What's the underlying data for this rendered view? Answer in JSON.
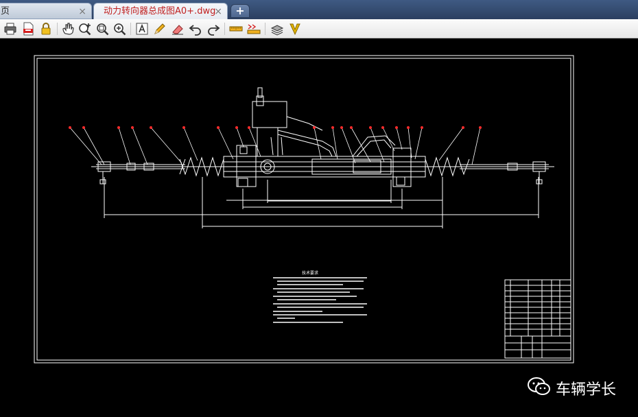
{
  "tabs": [
    {
      "label": "页",
      "active": false
    },
    {
      "label": "动力转向器总成图A0+.dwg",
      "active": true
    }
  ],
  "new_tab_label": "+",
  "tab_close_glyph": "×",
  "toolbar": [
    {
      "icon": "printer-icon"
    },
    {
      "icon": "pdf-export-icon"
    },
    {
      "icon": "lock-icon"
    },
    {
      "icon": "pan-hand-icon"
    },
    {
      "icon": "zoom-in-icon"
    },
    {
      "icon": "zoom-window-icon"
    },
    {
      "icon": "zoom-extents-icon"
    },
    {
      "icon": "text-tool-icon"
    },
    {
      "icon": "pencil-icon"
    },
    {
      "icon": "eraser-icon"
    },
    {
      "icon": "undo-icon"
    },
    {
      "icon": "redo-icon"
    },
    {
      "icon": "measure-distance-icon"
    },
    {
      "icon": "measure-area-icon"
    },
    {
      "icon": "layers-icon"
    },
    {
      "icon": "vip-icon"
    }
  ],
  "drawing": {
    "notes_heading": "技术要求"
  },
  "watermark": {
    "text": "车辆学长"
  },
  "colors": {
    "canvas_bg": "#000000",
    "line": "#ffffff",
    "leader_red": "#ff2a2a",
    "active_tab_text": "#c02020",
    "vip_yellow": "#e2b400"
  }
}
